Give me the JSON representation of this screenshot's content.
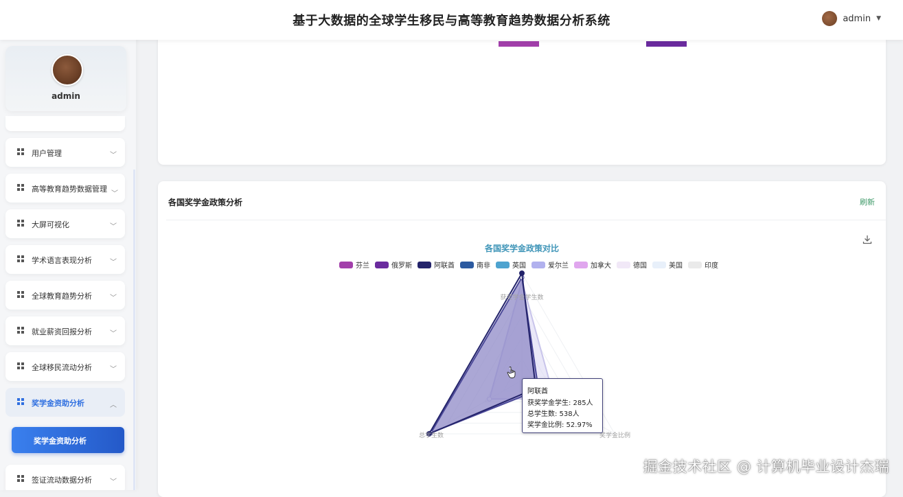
{
  "header": {
    "title": "基于大数据的全球学生移民与高等教育趋势数据分析系统",
    "username": "admin"
  },
  "sidebar": {
    "profile_name": "admin",
    "items": [
      {
        "label": "用户管理",
        "icon": "grid-icon"
      },
      {
        "label": "高等教育趋势数据管理",
        "icon": "grid-icon"
      },
      {
        "label": "大屏可视化",
        "icon": "grid-icon"
      },
      {
        "label": "学术语言表现分析",
        "icon": "grid-icon"
      },
      {
        "label": "全球教育趋势分析",
        "icon": "grid-icon"
      },
      {
        "label": "就业薪资回报分析",
        "icon": "grid-icon"
      },
      {
        "label": "全球移民流动分析",
        "icon": "grid-icon"
      },
      {
        "label": "奖学金资助分析",
        "icon": "grid-icon",
        "active": true
      },
      {
        "label": "签证流动数据分析",
        "icon": "grid-icon"
      }
    ],
    "submenu": {
      "label": "奖学金资助分析"
    },
    "active_color": "#2f6fe0"
  },
  "card": {
    "title": "各国奖学金政策分析",
    "refresh": "刷新"
  },
  "chart_data": {
    "type": "radar",
    "title": "各国奖学金政策对比",
    "indicators": [
      "获奖学金学生数",
      "总学生数",
      "奖学金比例"
    ],
    "legend": [
      {
        "name": "芬兰",
        "color": "#a23faa"
      },
      {
        "name": "俄罗斯",
        "color": "#6a2b9e"
      },
      {
        "name": "阿联酋",
        "color": "#23236a"
      },
      {
        "name": "南非",
        "color": "#2c5aa0"
      },
      {
        "name": "英国",
        "color": "#4ea3cf"
      },
      {
        "name": "爱尔兰",
        "color": "#b1b1ee"
      },
      {
        "name": "加拿大",
        "color": "#e0a6ee"
      },
      {
        "name": "德国",
        "color": "#f1e8f7"
      },
      {
        "name": "美国",
        "color": "#e8f0fa"
      },
      {
        "name": "印度",
        "color": "#eaeaea"
      }
    ],
    "highlight_series": "阿联酋",
    "tooltip": {
      "series": "阿联酋",
      "line1": "获奖学金学生: 285人",
      "line2": "总学生数: 538人",
      "line3": "奖学金比例: 52.97%"
    }
  },
  "watermark": "掘金技术社区 @ 计算机毕业设计杰瑞"
}
